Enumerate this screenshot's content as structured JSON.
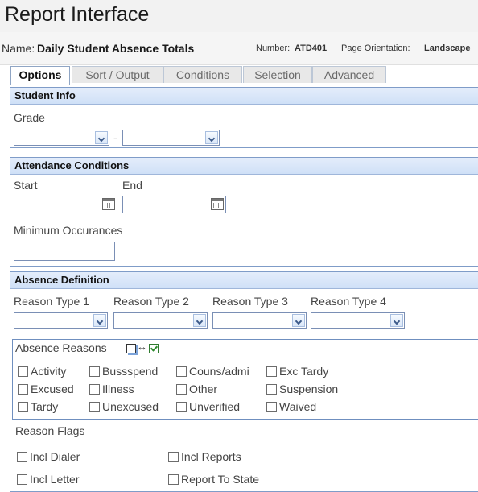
{
  "page": {
    "title": "Report Interface"
  },
  "report": {
    "name_label": "Name:",
    "name": "Daily Student Absence Totals",
    "number_label": "Number:",
    "number": "ATD401",
    "orientation_label": "Page Orientation:",
    "orientation": "Landscape"
  },
  "tabs": [
    {
      "label": "Options",
      "active": true
    },
    {
      "label": "Sort / Output"
    },
    {
      "label": "Conditions"
    },
    {
      "label": "Selection"
    },
    {
      "label": "Advanced"
    }
  ],
  "student_info": {
    "header": "Student Info",
    "grade_label": "Grade",
    "separator": "-",
    "grade_from": "",
    "grade_to": ""
  },
  "attendance": {
    "header": "Attendance Conditions",
    "start_label": "Start",
    "end_label": "End",
    "start_value": "",
    "end_value": "",
    "min_label": "Minimum Occurances",
    "min_value": ""
  },
  "absence": {
    "header": "Absence Definition",
    "reason_types": [
      "Reason Type 1",
      "Reason Type 2",
      "Reason Type 3",
      "Reason Type 4"
    ],
    "reasons_label": "Absence Reasons",
    "swap_glyph": "↔",
    "reasons": [
      "Activity",
      "Bussspend",
      "Couns/admi",
      "Exc Tardy",
      "Excused",
      "Illness",
      "Other",
      "Suspension",
      "Tardy",
      "Unexcused",
      "Unverified",
      "Waived"
    ],
    "flags_label": "Reason Flags",
    "flags": [
      "Incl Dialer",
      "Incl Reports",
      "Incl Letter",
      "Report To State"
    ]
  }
}
